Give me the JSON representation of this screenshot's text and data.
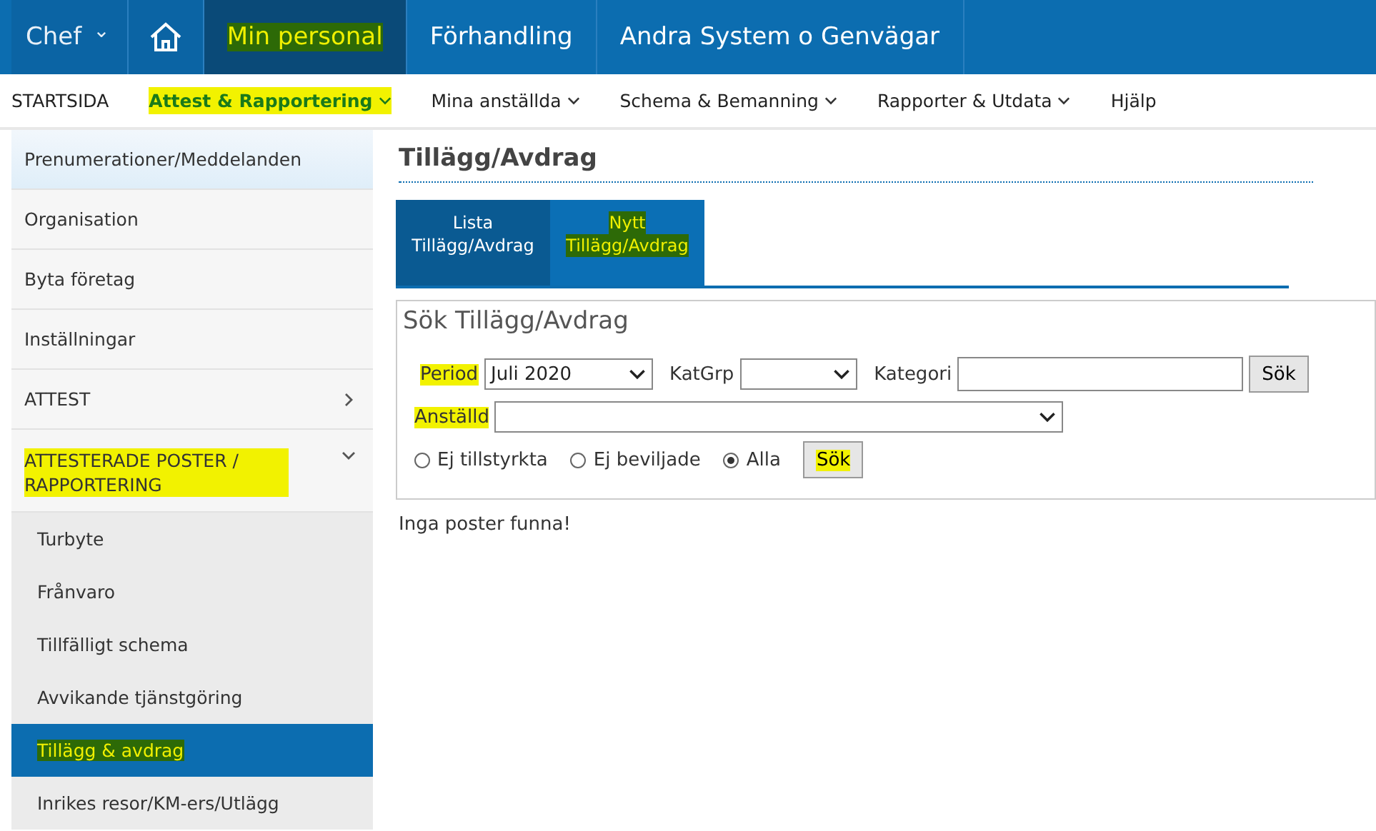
{
  "top_bar": {
    "menu": {
      "label": "Chef",
      "caret": "⌄"
    },
    "tabs": [
      {
        "label": "Min personal",
        "selected": true,
        "highlighted": true
      },
      {
        "label": "Förhandling",
        "selected": false,
        "highlighted": false
      },
      {
        "label": "Andra System o Genvägar",
        "selected": false,
        "highlighted": false
      }
    ]
  },
  "nav": [
    {
      "label": "STARTSIDA",
      "selected": false,
      "highlighted": false,
      "has_caret": false
    },
    {
      "label": "Attest & Rapportering",
      "selected": true,
      "highlighted": true,
      "has_caret": true
    },
    {
      "label": "Mina anställda",
      "selected": false,
      "highlighted": false,
      "has_caret": true
    },
    {
      "label": "Schema & Bemanning",
      "selected": false,
      "highlighted": false,
      "has_caret": true
    },
    {
      "label": "Rapporter & Utdata",
      "selected": false,
      "highlighted": false,
      "has_caret": true
    },
    {
      "label": "Hjälp",
      "selected": false,
      "highlighted": false,
      "has_caret": false
    }
  ],
  "sidebar": {
    "items": [
      {
        "label": "Prenumerationer/Meddelanden",
        "selected": false,
        "highlighted": false,
        "kind": "link"
      },
      {
        "label": "Organisation",
        "selected": false,
        "highlighted": false,
        "kind": "link"
      },
      {
        "label": "Byta företag",
        "selected": false,
        "highlighted": false,
        "kind": "link"
      },
      {
        "label": "Inställningar",
        "selected": false,
        "highlighted": false,
        "kind": "link"
      },
      {
        "label": "ATTEST",
        "selected": false,
        "highlighted": false,
        "kind": "group",
        "expanded": false
      },
      {
        "label": "ATTESTERADE POSTER / RAPPORTERING",
        "selected": false,
        "highlighted": true,
        "kind": "group",
        "expanded": true,
        "children": [
          {
            "label": "Turbyte",
            "selected": false,
            "highlighted": false
          },
          {
            "label": "Frånvaro",
            "selected": false,
            "highlighted": false
          },
          {
            "label": "Tillfälligt schema",
            "selected": false,
            "highlighted": false
          },
          {
            "label": "Avvikande tjänstgöring",
            "selected": false,
            "highlighted": false
          },
          {
            "label": "Tillägg & avdrag",
            "selected": true,
            "highlighted": true
          },
          {
            "label": "Inrikes resor/KM-ers/Utlägg",
            "selected": false,
            "highlighted": false
          }
        ]
      }
    ]
  },
  "content": {
    "title": "Tillägg/Avdrag",
    "tabs": [
      {
        "line1": "Lista",
        "line2": "Tillägg/Avdrag",
        "selected": true,
        "highlighted": false
      },
      {
        "line1": "Nytt",
        "line2": "Tillägg/Avdrag",
        "selected": false,
        "highlighted": true
      }
    ],
    "search": {
      "title": "Sök Tillägg/Avdrag",
      "period": {
        "label": "Period",
        "value": "Juli 2020",
        "highlighted": true
      },
      "katgrp": {
        "label": "KatGrp",
        "highlighted": false
      },
      "kategori": {
        "label": "Kategori",
        "highlighted": false
      },
      "kategori_button": {
        "label": "Sök",
        "highlighted": false
      },
      "anstalld": {
        "label": "Anställd",
        "highlighted": true
      },
      "filters": [
        {
          "label": "Ej tillstyrkta",
          "selected": false
        },
        {
          "label": "Ej beviljade",
          "selected": false
        },
        {
          "label": "Alla",
          "selected": true
        }
      ],
      "search_button": {
        "label": "Sök",
        "highlighted": true
      }
    },
    "message": "Inga poster funna!"
  }
}
